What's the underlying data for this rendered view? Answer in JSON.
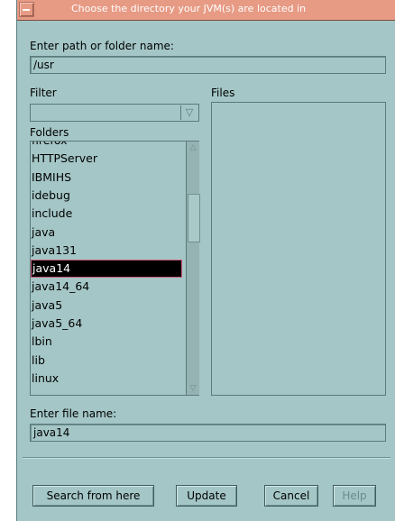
{
  "window": {
    "title": "Choose the directory your JVM(s) are located in"
  },
  "path": {
    "label": "Enter path or folder name:",
    "value": "/usr"
  },
  "filter": {
    "label": "Filter",
    "value": ""
  },
  "files": {
    "label": "Files",
    "items": []
  },
  "folders": {
    "label": "Folders",
    "items": [
      "firefox",
      "HTTPServer",
      "IBMIHS",
      "idebug",
      "include",
      "java",
      "java131",
      "java14",
      "java14_64",
      "java5",
      "java5_64",
      "lbin",
      "lib",
      "linux"
    ],
    "selected": "java14"
  },
  "file_name": {
    "label": "Enter file name:",
    "value": "java14"
  },
  "buttons": {
    "search": "Search from here",
    "update": "Update",
    "cancel": "Cancel",
    "help": "Help"
  },
  "colors": {
    "background": "#a4c6c6",
    "titlebar": "#e79a84",
    "selection": "#000000"
  }
}
